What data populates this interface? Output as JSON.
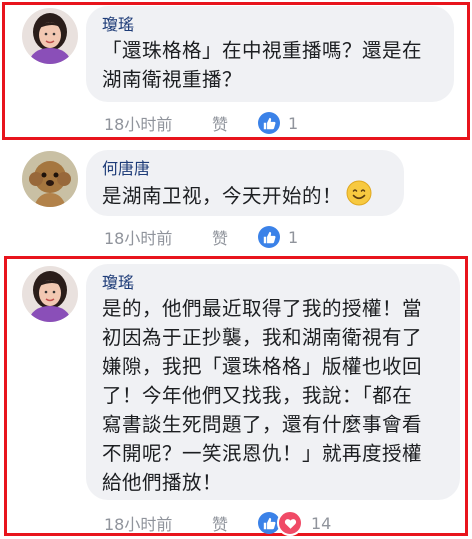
{
  "comments": [
    {
      "author": "瓊瑤",
      "text_lines": [
        "「還珠格格」在中視重播嗎？還是在",
        "湖南衛視重播？"
      ],
      "time": "18小时前",
      "like_label": "赞",
      "reaction_count": "1",
      "highlighted": true
    },
    {
      "author": "何唐唐",
      "text_lines": [
        "是湖南卫视，今天开始的！"
      ],
      "emoji": "smiling-face-emoji",
      "time": "18小时前",
      "like_label": "赞",
      "reaction_count": "1",
      "highlighted": false
    },
    {
      "author": "瓊瑤",
      "text_lines": [
        "是的，他們最近取得了我的授權！當",
        "初因為于正抄襲，我和湖南衛視有了",
        "嫌隙，我把「還珠格格」版權也收回",
        "了！今年他們又找我，我說：「都在",
        "寫書談生死問題了，還有什麼事會看",
        "不開呢？一笑泯恩仇！」就再度授權",
        "給他們播放！"
      ],
      "time": "18小时前",
      "like_label": "赞",
      "reaction_count": "14",
      "highlighted": true
    }
  ],
  "colors": {
    "highlight_border": "#e8141c",
    "bubble_bg": "#f0f1f4",
    "author_name": "#1e3c78",
    "meta_text": "#90949c",
    "like_blue": "#3b82e8",
    "love_red": "#f04a66"
  }
}
